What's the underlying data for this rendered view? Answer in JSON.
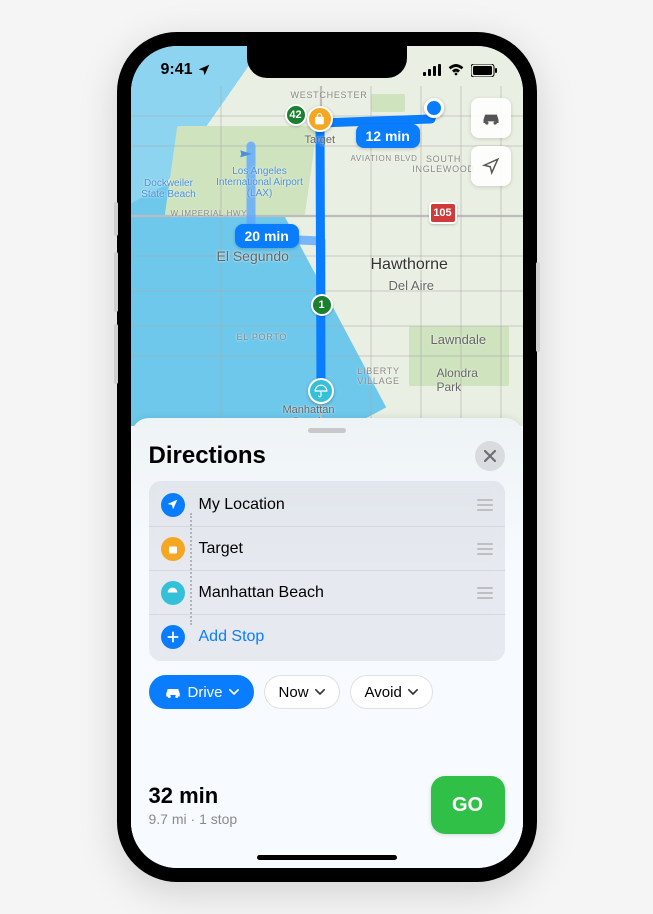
{
  "status": {
    "time": "9:41"
  },
  "map": {
    "labels": {
      "westchester": "WESTCHESTER",
      "aviation": "AVIATION BLVD",
      "south_inglewood": "SOUTH INGLEWOOD",
      "dockweiler": "Dockweiler State Beach",
      "lax": "Los Angeles International Airport (LAX)",
      "imperial": "W IMPERIAL HWY",
      "el_segundo": "El Segundo",
      "hawthorne": "Hawthorne",
      "del_aire": "Del Aire",
      "el_porto": "EL PORTO",
      "manhattan": "Manhattan Beach",
      "lawndale": "Lawndale",
      "liberty": "LIBERTY VILLAGE",
      "alondra": "Alondra Park",
      "target": "Target"
    },
    "etas": {
      "primary": "12 min",
      "alt": "20 min"
    },
    "shields": {
      "hwy1": "1",
      "ca42": "42",
      "i105": "105"
    }
  },
  "sheet": {
    "title": "Directions",
    "stops": [
      {
        "label": "My Location",
        "kind": "loc"
      },
      {
        "label": "Target",
        "kind": "target"
      },
      {
        "label": "Manhattan Beach",
        "kind": "beach"
      }
    ],
    "add_stop": "Add Stop",
    "mode": {
      "drive": "Drive",
      "time": "Now",
      "avoid": "Avoid"
    },
    "summary": {
      "time": "32 min",
      "sub": "9.7 mi · 1 stop",
      "go": "GO"
    }
  }
}
